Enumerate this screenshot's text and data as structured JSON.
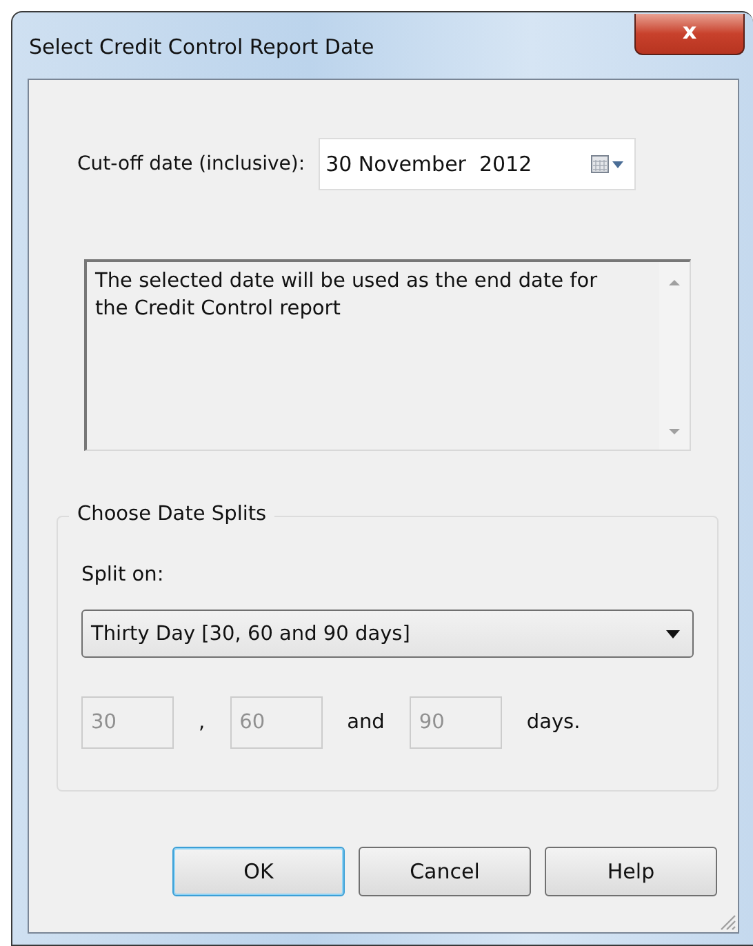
{
  "window": {
    "title": "Select Credit Control Report Date",
    "close_label": "x"
  },
  "cutoff": {
    "label": "Cut-off date (inclusive):",
    "value": "30 November  2012"
  },
  "description": {
    "value": "The selected date will be used as the end date for the Credit Control report"
  },
  "date_splits": {
    "title": "Choose Date Splits",
    "split_label": "Split on:",
    "split_value": "Thirty Day [30, 60 and 90 days]",
    "fields": [
      {
        "value": "30",
        "disabled": true,
        "after": ","
      },
      {
        "value": "60",
        "disabled": true,
        "after": "and"
      },
      {
        "value": "90",
        "disabled": true,
        "after": "days."
      }
    ]
  },
  "buttons": [
    {
      "label": "OK",
      "focused": true
    },
    {
      "label": "Cancel",
      "focused": false
    },
    {
      "label": "Help",
      "focused": false
    }
  ]
}
